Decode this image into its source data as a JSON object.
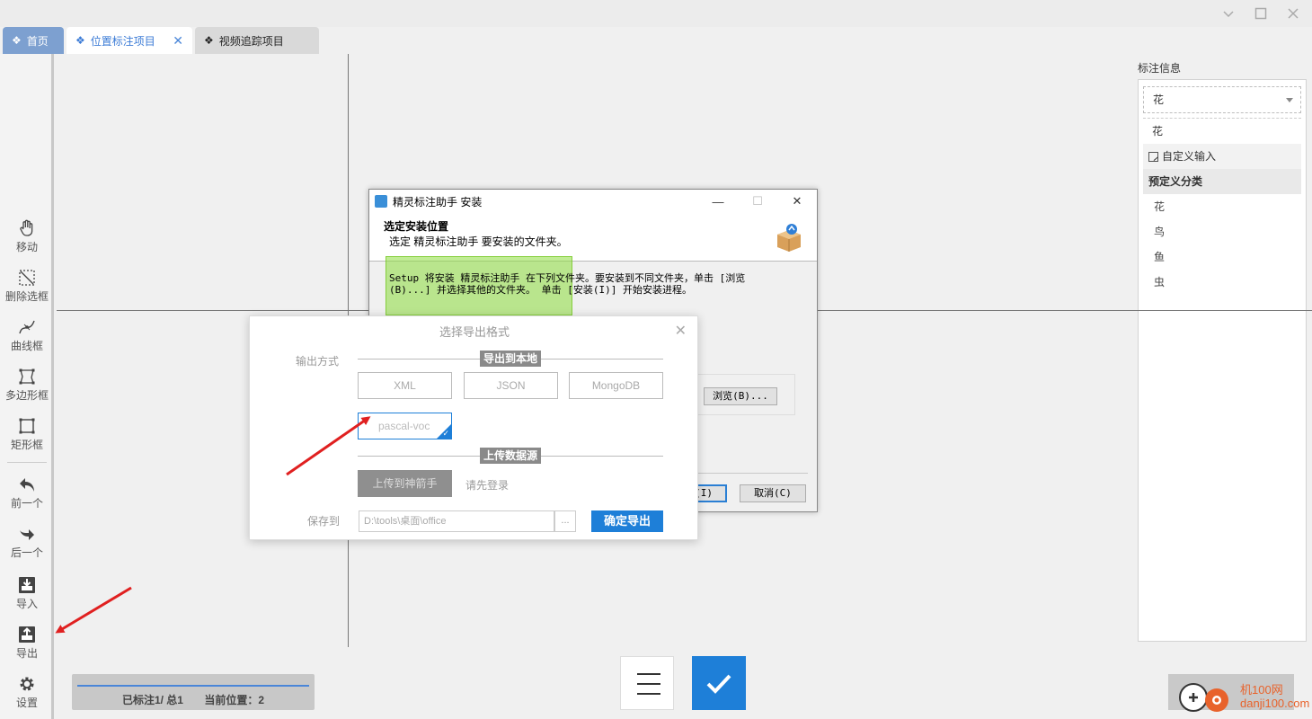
{
  "window": {
    "controls": [
      "chevron-down-icon",
      "maximize-icon",
      "close-icon"
    ]
  },
  "tabs": [
    {
      "label": "首页",
      "icon": "diamond-icon"
    },
    {
      "label": "位置标注项目",
      "icon": "diamond-icon",
      "closable": true,
      "close": "✕"
    },
    {
      "label": "视频追踪项目",
      "icon": "diamond-icon"
    }
  ],
  "tools": [
    {
      "label": "移动",
      "icon": "hand-icon"
    },
    {
      "label": "删除选框",
      "icon": "delete-box-icon"
    },
    {
      "label": "曲线框",
      "icon": "curve-icon"
    },
    {
      "label": "多边形框",
      "icon": "polygon-icon"
    },
    {
      "label": "矩形框",
      "icon": "rectangle-icon"
    },
    {
      "label": "前一个",
      "icon": "undo-arrow-icon"
    },
    {
      "label": "后一个",
      "icon": "redo-arrow-icon"
    },
    {
      "label": "导入",
      "icon": "import-icon"
    },
    {
      "label": "导出",
      "icon": "export-icon"
    },
    {
      "label": "设置",
      "icon": "gear-icon"
    }
  ],
  "right_panel": {
    "title": "标注信息",
    "selected": "花",
    "current": "花",
    "custom_input": "自定义输入",
    "group_title": "预定义分类",
    "categories": [
      "花",
      "鸟",
      "鱼",
      "虫"
    ]
  },
  "status": {
    "labeled": "已标注1/ 总1",
    "position": "当前位置：2",
    "progress": 1.0
  },
  "installer": {
    "title": "精灵标注助手 安装",
    "heading": "选定安装位置",
    "subheading": "选定 精灵标注助手 要安装的文件夹。",
    "body_line1": "Setup 将安装 精灵标注助手 在下列文件夹。要安装到不同文件夹，单击 [浏览",
    "body_line2": "(B)...] 并选择其他的文件夹。 单击 [安装(I)] 开始安装进程。",
    "browse": "浏览(B)...",
    "install": "(I)",
    "cancel": "取消(C)",
    "minimize": "—",
    "maximize": "☐",
    "close": "✕"
  },
  "export_dialog": {
    "title": "选择导出格式",
    "close": "✕",
    "output_label": "输出方式",
    "local_section": "导出到本地",
    "formats": [
      "XML",
      "JSON",
      "MongoDB",
      "pascal-voc"
    ],
    "selected_format": "pascal-voc",
    "upload_section": "上传数据源",
    "upload_button": "上传到神箭手",
    "login_hint": "请先登录",
    "save_label": "保存到",
    "save_path": "D:\\tools\\桌面\\office",
    "browse_dots": "...",
    "confirm": "确定导出"
  },
  "watermark": {
    "line1": "机100网",
    "line2": "danji100.com"
  },
  "colors": {
    "accent": "#1e7fd8",
    "arrow": "#e02020",
    "tab_home": "#7da0d0"
  }
}
